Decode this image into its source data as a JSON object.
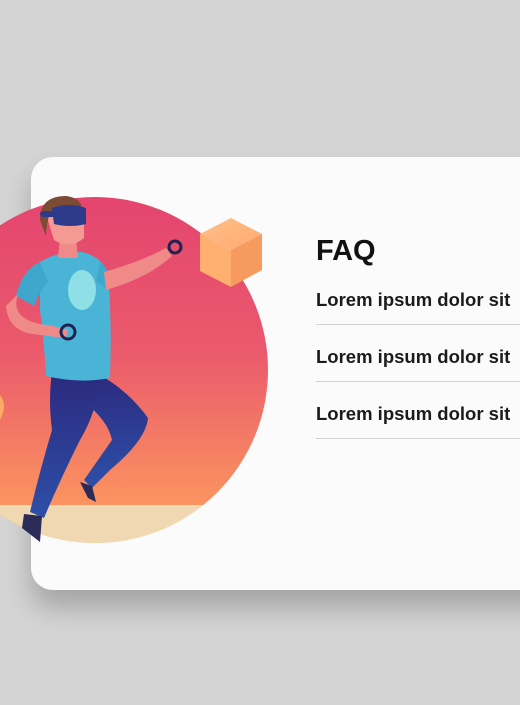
{
  "faq": {
    "title": "FAQ",
    "items": [
      {
        "question": "Lorem ipsum dolor sit"
      },
      {
        "question": "Lorem ipsum dolor sit"
      },
      {
        "question": "Lorem ipsum dolor sit"
      }
    ]
  },
  "illustration": {
    "icon": "vr-person-illustration",
    "colors": {
      "circle_top": "#e6476d",
      "circle_bottom": "#ff9a5a",
      "ground": "#f2dcb4",
      "shirt": "#4db6d6",
      "pants": "#27308a",
      "cube": "#ffad6e"
    }
  }
}
